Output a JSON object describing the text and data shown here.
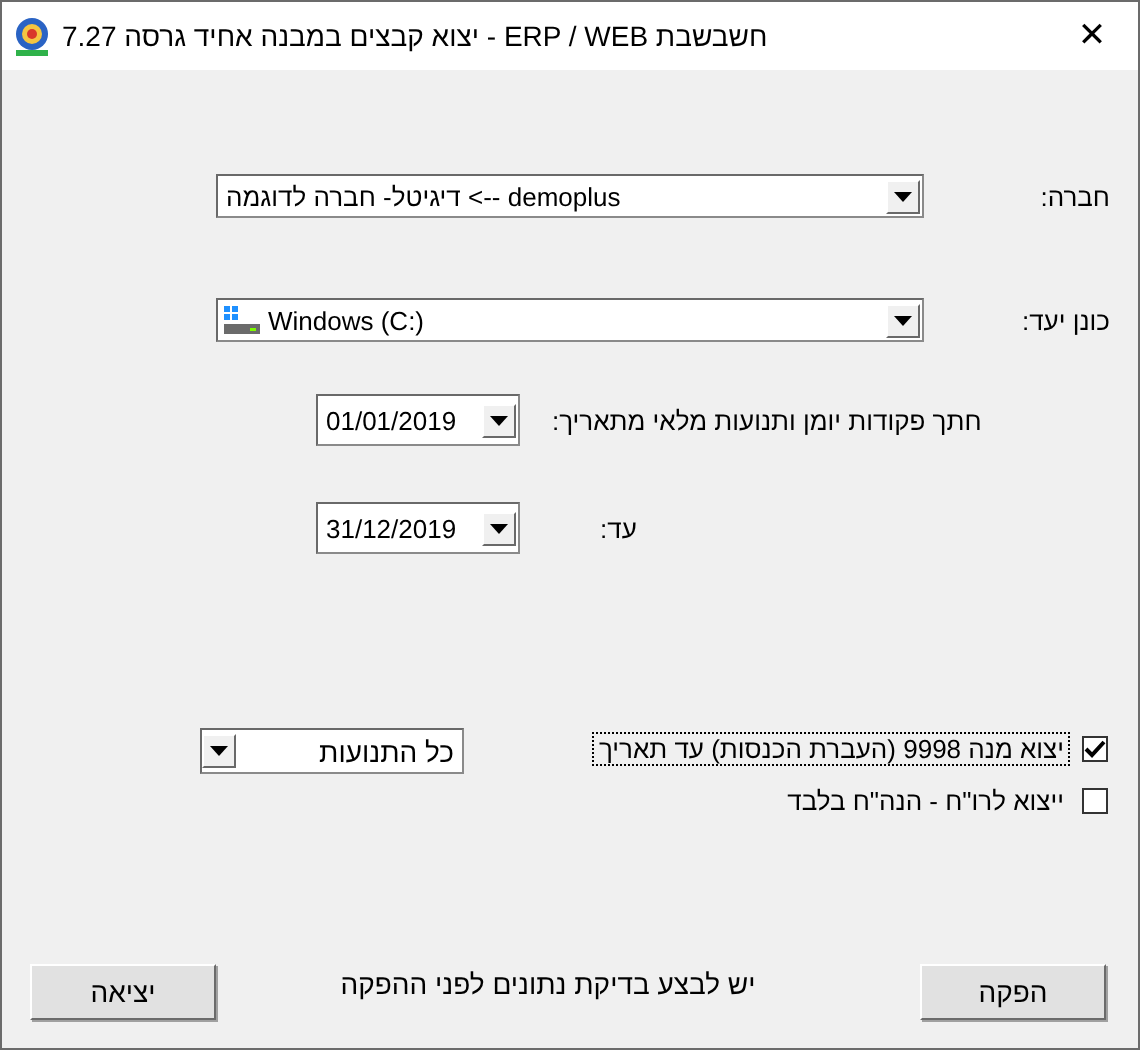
{
  "window": {
    "title": "חשבשבת ERP / WEB - יצוא קבצים במבנה אחיד גרסה 7.27",
    "close": "✕"
  },
  "company": {
    "label": "חברה:",
    "value": "דיגיטל- חברה לדוגמה <-- demoplus"
  },
  "drive": {
    "label": "כונן יעד:",
    "value": "Windows (C:)"
  },
  "from_date": {
    "label": "חתך פקודות יומן ותנועות מלאי  מתאריך:",
    "value": "01/01/2019"
  },
  "to_date": {
    "label": "עד:",
    "value": "31/12/2019"
  },
  "options": [
    {
      "label": "יצוא מנה 9998 (העברת הכנסות) עד תאריך",
      "checked": true,
      "focused": true
    },
    {
      "label": "ייצוא לרו\"ח - הנה\"ח בלבד",
      "checked": false,
      "focused": false
    }
  ],
  "movements": {
    "value": "כל התנועות"
  },
  "note": "יש לבצע בדיקת נתונים לפני ההפקה",
  "buttons": {
    "export": "הפקה",
    "exit": "יציאה"
  }
}
